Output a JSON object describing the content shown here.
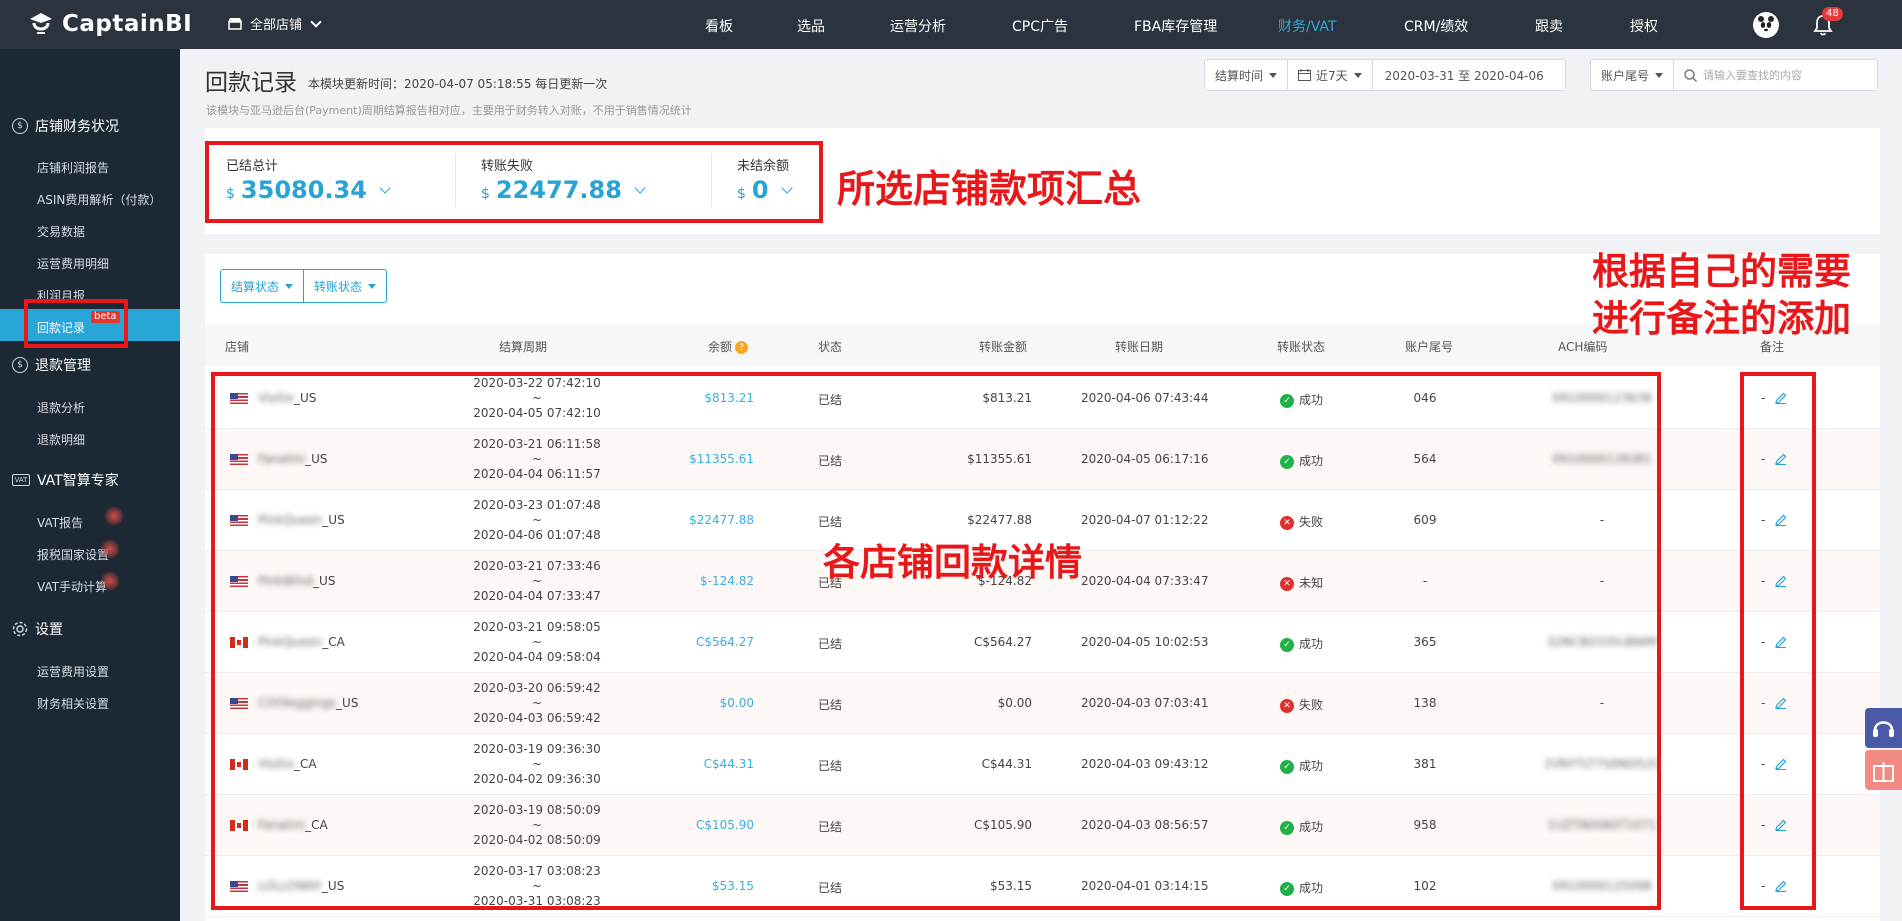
{
  "app": {
    "logo_text": "CaptainBI",
    "store_selector": "全部店铺",
    "notification_count": "48"
  },
  "nav": [
    {
      "label": "看板"
    },
    {
      "label": "选品"
    },
    {
      "label": "运营分析"
    },
    {
      "label": "CPC广告"
    },
    {
      "label": "FBA库存管理"
    },
    {
      "label": "财务/VAT",
      "active": true
    },
    {
      "label": "CRM/绩效"
    },
    {
      "label": "跟卖"
    },
    {
      "label": "授权"
    }
  ],
  "sidebar": {
    "sections": [
      {
        "title": "店铺财务状况",
        "items": [
          "店铺利润报告",
          "ASIN费用解析（付款）",
          "交易数据",
          "运营费用明细",
          "利润月报",
          "回款记录"
        ]
      },
      {
        "title": "退款管理",
        "items": [
          "退款分析",
          "退款明细"
        ]
      },
      {
        "title": "VAT智算专家",
        "icon_text": "VAT",
        "items": [
          "VAT报告",
          "报税国家设置",
          "VAT手动计算"
        ]
      },
      {
        "title": "设置",
        "items": [
          "运营费用设置",
          "财务相关设置"
        ]
      }
    ],
    "active_item": "回款记录",
    "beta_badge": "beta"
  },
  "page": {
    "title": "回款记录",
    "update_info": "本模块更新时间：2020-04-07 05:18:55  每日更新一次",
    "description": "该模块与亚马逊后台(Payment)周期结算报告相对应，主要用于财务转入对账，不用于销售情况统计"
  },
  "filters": {
    "time_type": "结算时间",
    "range_preset": "近7天",
    "date_range": "2020-03-31 至 2020-04-06",
    "account_field": "账户尾号",
    "search_placeholder": "请输入要查找的内容"
  },
  "summary": {
    "currency": "$",
    "items": [
      {
        "label": "已结总计",
        "value": "35080.34"
      },
      {
        "label": "转账失败",
        "value": "22477.88"
      },
      {
        "label": "未结余额",
        "value": "0"
      }
    ]
  },
  "table_filters": {
    "settle_status": "结算状态",
    "transfer_status": "转账状态"
  },
  "table": {
    "headers": [
      "店铺",
      "结算周期",
      "余额",
      "状态",
      "转账金额",
      "转账日期",
      "转账状态",
      "账户尾号",
      "ACH编码",
      "备注"
    ],
    "rows": [
      {
        "flag": "us",
        "store_prefix": "Visitix",
        "store_suffix": "_US",
        "period_start": "2020-03-22 07:42:10",
        "period_end": "2020-04-05 07:42:10",
        "balance": "$813.21",
        "status": "已结",
        "amount": "$813.21",
        "date": "2020-04-06 07:43:44",
        "transfer_ok": true,
        "transfer_status": "成功",
        "account_tail": "046",
        "ach": "0910000123638",
        "note": "-"
      },
      {
        "flag": "us",
        "store_prefix": "Fanatini",
        "store_suffix": "_US",
        "period_start": "2020-03-21 06:11:58",
        "period_end": "2020-04-04 06:11:57",
        "balance": "$11355.61",
        "status": "已结",
        "amount": "$11355.61",
        "date": "2020-04-05 06:17:16",
        "transfer_ok": true,
        "transfer_status": "成功",
        "account_tail": "564",
        "ach": "0910000128381",
        "note": "-"
      },
      {
        "flag": "us",
        "store_prefix": "PinkQueen",
        "store_suffix": "_US",
        "period_start": "2020-03-23 01:07:48",
        "period_end": "2020-04-06 01:07:48",
        "balance": "$22477.88",
        "status": "已结",
        "amount": "$22477.88",
        "date": "2020-04-07 01:12:22",
        "transfer_ok": false,
        "transfer_status": "失败",
        "account_tail": "609",
        "ach": "-",
        "note": "-"
      },
      {
        "flag": "us",
        "store_prefix": "PinkWind",
        "store_suffix": "_US",
        "period_start": "2020-03-21 07:33:46",
        "period_end": "2020-04-04 07:33:47",
        "balance": "$-124.82",
        "status": "已结",
        "amount": "$-124.82",
        "date": "2020-04-04 07:33:47",
        "transfer_ok": false,
        "transfer_status": "未知",
        "account_tail": "-",
        "ach": "-",
        "note": "-"
      },
      {
        "flag": "ca",
        "store_prefix": "PinkQueen",
        "store_suffix": "_CA",
        "period_start": "2020-03-21 09:58:05",
        "period_end": "2020-04-04 09:58:04",
        "balance": "C$564.27",
        "status": "已结",
        "amount": "C$564.27",
        "date": "2020-04-05 10:02:53",
        "transfer_ok": true,
        "transfer_status": "成功",
        "account_tail": "365",
        "ach": "32NCB0335UBWM",
        "note": "-"
      },
      {
        "flag": "us",
        "store_prefix": "COOleggings",
        "store_suffix": "_US",
        "period_start": "2020-03-20 06:59:42",
        "period_end": "2020-04-03 06:59:42",
        "balance": "$0.00",
        "status": "已结",
        "amount": "$0.00",
        "date": "2020-04-03 07:03:41",
        "transfer_ok": false,
        "transfer_status": "失败",
        "account_tail": "138",
        "ach": "-",
        "note": "-"
      },
      {
        "flag": "ca",
        "store_prefix": "Visitix",
        "store_suffix": "_CA",
        "period_start": "2020-03-19 09:36:30",
        "period_end": "2020-04-02 09:36:30",
        "balance": "C$44.31",
        "status": "已结",
        "amount": "C$44.31",
        "date": "2020-04-03 09:43:12",
        "transfer_ok": true,
        "transfer_status": "成功",
        "account_tail": "381",
        "ach": "2VNYTLT7S0ND52C",
        "note": "-"
      },
      {
        "flag": "ca",
        "store_prefix": "Fanatini",
        "store_suffix": "_CA",
        "period_start": "2020-03-19 08:50:09",
        "period_end": "2020-04-02 08:50:09",
        "balance": "C$105.90",
        "status": "已结",
        "amount": "C$105.90",
        "date": "2020-04-03 08:56:57",
        "transfer_ok": true,
        "transfer_status": "成功",
        "account_tail": "958",
        "ach": "1UZTN0060T1071",
        "note": "-"
      },
      {
        "flag": "us",
        "store_prefix": "LOLLOWAY",
        "store_suffix": "_US",
        "period_start": "2020-03-17 03:08:23",
        "period_end": "2020-03-31 03:08:23",
        "balance": "$53.15",
        "status": "已结",
        "amount": "$53.15",
        "date": "2020-04-01 03:14:15",
        "transfer_ok": true,
        "transfer_status": "成功",
        "account_tail": "102",
        "ach": "0910000125098",
        "note": "-"
      }
    ]
  },
  "annotations": {
    "summary": "所选店铺款项汇总",
    "details": "各店铺回款详情",
    "notes_line1": "根据自己的需要",
    "notes_line2": "进行备注的添加"
  },
  "colors": {
    "accent": "#27a3d4",
    "topbar": "#2b333e",
    "sidebar": "#1c2833",
    "annotation": "#e8181a",
    "success": "#21b14a",
    "error": "#e0302e"
  }
}
